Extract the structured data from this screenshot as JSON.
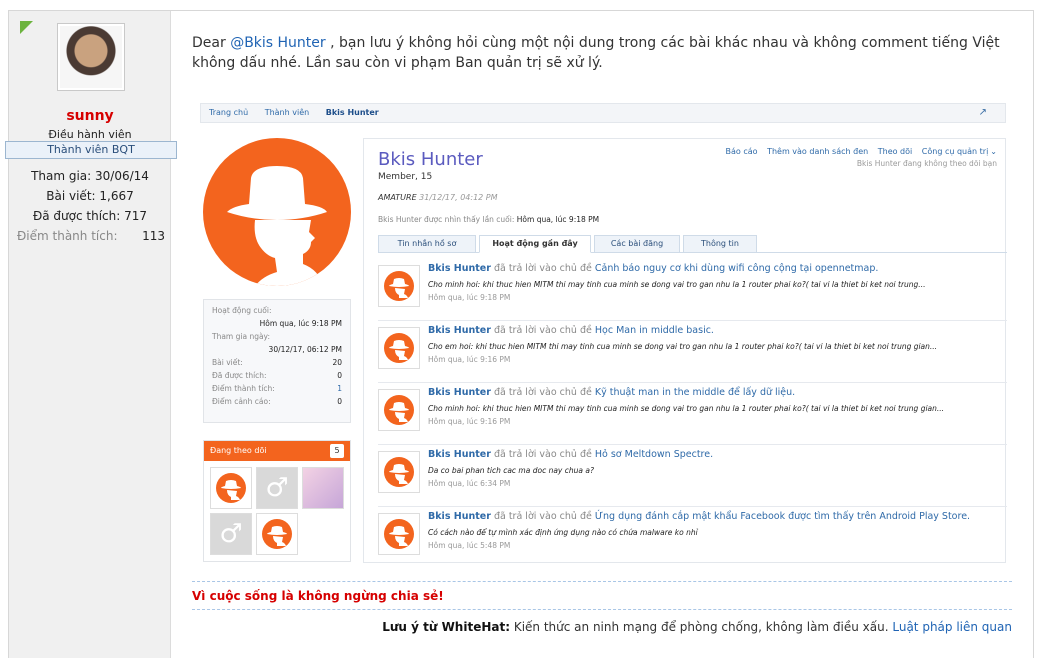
{
  "author": {
    "username": "sunny",
    "role": "Điều hành viên",
    "badge": "Thành viên BQT",
    "joined": "Tham gia: 30/06/14",
    "posts": "Bài viết: 1,667",
    "likes": "Đã được thích: 717",
    "points_label": "Điểm thành tích:",
    "points_value": "113"
  },
  "message": {
    "text_before": "Dear ",
    "mention": "@Bkis Hunter",
    "text_after": " , bạn lưu ý không hỏi cùng một nội dung trong các bài khác nhau và không comment tiếng Việt không dấu nhé. Lần sau còn vi phạm Ban quản trị sẽ xử lý."
  },
  "screenshot": {
    "breadcrumbs": [
      "Trang chủ",
      "Thành viên",
      "Bkis Hunter"
    ],
    "profile": {
      "name": "Bkis Hunter",
      "member_line": "Member, 15",
      "status": "AMATURE",
      "status_time": "31/12/17, 04:12 PM",
      "last_seen_label": "Bkis Hunter được nhìn thấy lần cuối:",
      "last_seen_value": "Hôm qua, lúc 9:18 PM",
      "tools": [
        "Báo cáo",
        "Thêm vào danh sách đen",
        "Theo dõi",
        "Công cụ quản trị"
      ],
      "follow_note": "Bkis Hunter đang không theo dõi bạn"
    },
    "info": {
      "last_active_label": "Hoạt động cuối:",
      "last_active_value": "Hôm qua, lúc 9:18 PM",
      "joined_label": "Tham gia ngày:",
      "joined_value": "30/12/17, 06:12 PM",
      "posts_label": "Bài viết:",
      "posts_value": "20",
      "likes_label": "Đã được thích:",
      "likes_value": "0",
      "points_label": "Điểm thành tích:",
      "points_value": "1",
      "warn_label": "Điểm cảnh cáo:",
      "warn_value": "0"
    },
    "following": {
      "label": "Đang theo dõi",
      "count": "5"
    },
    "tabs": [
      "Tin nhắn hồ sơ",
      "Hoạt động gần đây",
      "Các bài đăng",
      "Thông tin"
    ],
    "feed": [
      {
        "who": "Bkis Hunter",
        "action": " đã trả lời vào chủ đề ",
        "title": "Cảnh báo nguy cơ khi dùng wifi công cộng tại opennetmap.",
        "snippet": "Cho minh hoi: khi thuc hien MITM thi may tinh cua minh se dong vai tro gan nhu la 1 router phai ko?( tai vi la thiet bi ket noi trung...",
        "time": "Hôm qua, lúc 9:18 PM"
      },
      {
        "who": "Bkis Hunter",
        "action": " đã trả lời vào chủ đề ",
        "title": "Học Man in middle basic.",
        "snippet": "Cho em hoi: khi thuc hien MITM thi may tinh cua minh se dong vai tro gan nhu la 1 router phai ko?( tai vi la thiet bi ket noi trung gian...",
        "time": "Hôm qua, lúc 9:16 PM"
      },
      {
        "who": "Bkis Hunter",
        "action": " đã trả lời vào chủ đề ",
        "title": "Kỹ thuật man in the middle để lấy dữ liệu.",
        "snippet": "Cho minh hoi: khi thuc hien MITM thi may tinh cua minh se dong vai tro gan nhu la 1 router phai ko?( tai vi la thiet bi ket noi trung gian...",
        "time": "Hôm qua, lúc 9:16 PM"
      },
      {
        "who": "Bkis Hunter",
        "action": " đã trả lời vào chủ đề ",
        "title": "Hỏ sơ Meltdown Spectre.",
        "snippet": "Da co bai phan tich cac ma doc nay chua a?",
        "time": "Hôm qua, lúc 6:34 PM"
      },
      {
        "who": "Bkis Hunter",
        "action": " đã trả lời vào chủ đề ",
        "title": "Ứng dụng đánh cắp mật khẩu Facebook được tìm thấy trên Android Play Store.",
        "snippet": "Có cách nào để tự mình xác định ứng dụng nào có chứa malware ko nhỉ",
        "time": "Hôm qua, lúc 5:48 PM"
      }
    ]
  },
  "signature": {
    "line": "Vì cuộc sống là không ngừng chia sẻ!",
    "note_label": "Lưu ý từ WhiteHat:",
    "note_text": " Kiến thức an ninh mạng để phòng chống, không làm điều xấu. ",
    "note_link": "Luật pháp liên quan"
  },
  "colors": {
    "accent_orange": "#f3641e",
    "username_red": "#d60000",
    "link_blue": "#2064b4",
    "new_marker": "#6cb33e"
  },
  "icons": [
    "new-post-corner-icon",
    "external-link-icon",
    "dropdown-arrow-icon",
    "person-hat-icon",
    "male-symbol-icon"
  ]
}
